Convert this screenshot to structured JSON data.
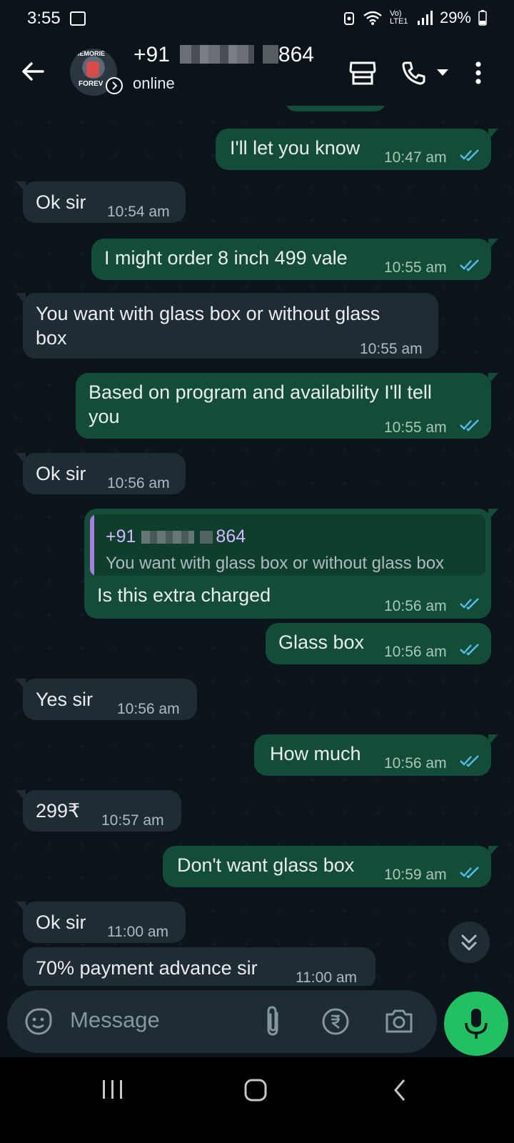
{
  "status_bar": {
    "time": "3:55",
    "network": "Vo) LTE1",
    "battery": "29%"
  },
  "header": {
    "title_prefix": "+91",
    "title_suffix": "864",
    "status": "online",
    "avatar_text_top": "MEMORIE",
    "avatar_text_bottom": "FOREV"
  },
  "messages": [
    {
      "dir": "out",
      "text": "I'll let you know",
      "time": "10:47 am"
    },
    {
      "dir": "in",
      "text": "Ok sir",
      "time": "10:54 am"
    },
    {
      "dir": "out",
      "text": "I might order 8 inch 499 vale",
      "time": "10:55 am"
    },
    {
      "dir": "in",
      "text_line1": "You want with glass box or without glass",
      "text_line2": "box",
      "time": "10:55 am"
    },
    {
      "dir": "out",
      "text_line1": "Based on program and availability I'll tell",
      "text_line2": "you",
      "time": "10:55 am"
    },
    {
      "dir": "in",
      "text": "Ok sir",
      "time": "10:56 am"
    },
    {
      "dir": "out",
      "quote_name_prefix": "+91",
      "quote_name_suffix": "864",
      "quote_text": "You want with glass box or without glass box",
      "text": "Is this extra charged",
      "time": "10:56 am"
    },
    {
      "dir": "out",
      "text": "Glass box",
      "time": "10:56 am"
    },
    {
      "dir": "in",
      "text": "Yes sir",
      "time": "10:56 am"
    },
    {
      "dir": "out",
      "text": "How much",
      "time": "10:56 am"
    },
    {
      "dir": "in",
      "text": "299₹",
      "time": "10:57 am"
    },
    {
      "dir": "out",
      "text": "Don't want glass box",
      "time": "10:59 am"
    },
    {
      "dir": "in",
      "text": "Ok sir",
      "time": "11:00 am"
    },
    {
      "dir": "in",
      "text": "70% payment advance sir",
      "time": "11:00 am"
    }
  ],
  "input": {
    "placeholder": "Message"
  },
  "colors": {
    "background": "#0b141a",
    "incoming_bubble": "#202c33",
    "outgoing_bubble": "#144d37",
    "read_tick": "#53bdeb",
    "mic_button": "#21c063"
  }
}
